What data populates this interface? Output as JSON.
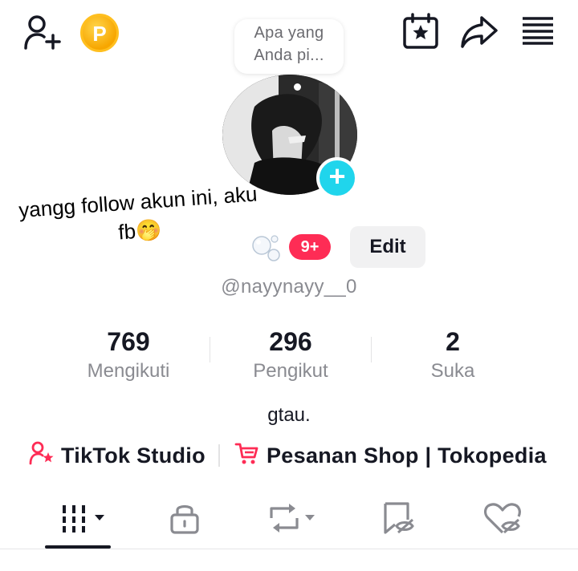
{
  "header": {
    "coin_letter": "P",
    "icons": [
      "add-friend-icon",
      "coin-icon",
      "calendar-star-icon",
      "share-icon",
      "menu-icon"
    ]
  },
  "note": {
    "line1": "Apa yang",
    "line2": "Anda pi..."
  },
  "overlay_text": {
    "line1": "yangg follow akun ini, aku",
    "line2": "fb🤭"
  },
  "profile": {
    "notification_badge": "9+",
    "edit_label": "Edit",
    "username": "@nayynayy__0",
    "bio": "gtau."
  },
  "stats": [
    {
      "value": "769",
      "label": "Mengikuti"
    },
    {
      "value": "296",
      "label": "Pengikut"
    },
    {
      "value": "2",
      "label": "Suka"
    }
  ],
  "links": {
    "studio": "TikTok Studio",
    "shop": "Pesanan Shop | Tokopedia"
  },
  "tabs": [
    "videos-grid-icon",
    "lock-icon",
    "repost-icon",
    "saved-icon",
    "liked-icon"
  ],
  "colors": {
    "accent": "#fe2c55",
    "avatar_plus": "#20d5ec",
    "coin": "#f7a600",
    "muted_text": "#8a8b91"
  }
}
